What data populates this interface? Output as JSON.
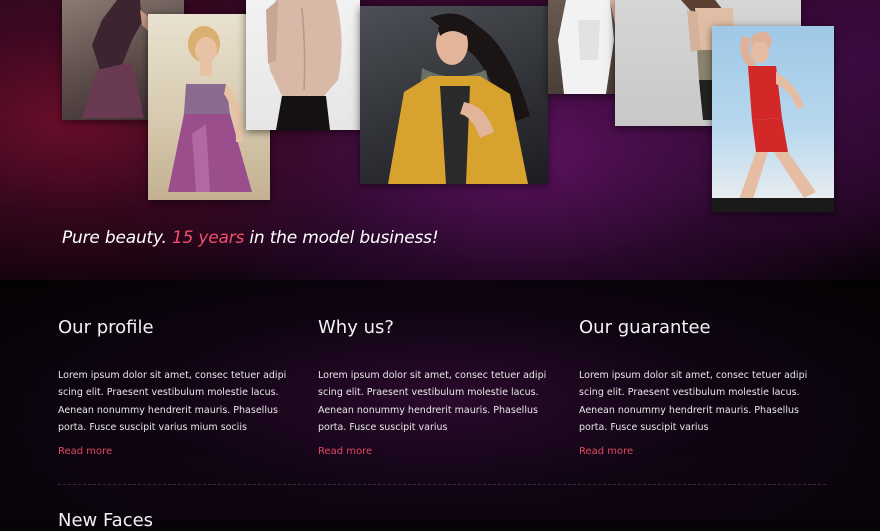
{
  "hero": {
    "tagline": {
      "lead": "Pure beauty.",
      "accent": "15 years",
      "tail": "in the model business!"
    },
    "photos": [
      "model-purple-dress",
      "model-sequin-dress",
      "model-bare-back",
      "model-yellow-jacket",
      "model-white-dress",
      "model-lace-top",
      "model-red-swimsuit"
    ]
  },
  "features": [
    {
      "title": "Our profile",
      "text": "Lorem ipsum dolor sit amet, consec tetuer adipi scing elit. Praesent vestibulum molestie lacus. Aenean nonummy hendrerit mauris. Phasellus porta. Fusce suscipit varius mium sociis",
      "link": "Read more"
    },
    {
      "title": "Why us?",
      "text": "Lorem ipsum dolor sit amet, consec tetuer adipi scing elit. Praesent vestibulum molestie lacus. Aenean nonummy hendrerit mauris. Phasellus porta. Fusce suscipit varius",
      "link": "Read more"
    },
    {
      "title": "Our guarantee",
      "text": "Lorem ipsum dolor sit amet, consec tetuer adipi scing elit. Praesent vestibulum molestie lacus. Aenean nonummy hendrerit mauris. Phasellus porta. Fusce suscipit varius",
      "link": "Read more"
    }
  ],
  "news": {
    "heading": "New Faces"
  },
  "colors": {
    "accent": "#f0506e",
    "link": "#e04a62",
    "hero_magenta": "#5e1262",
    "hero_crimson": "#6a0e2a",
    "page_bg": "#080308"
  }
}
